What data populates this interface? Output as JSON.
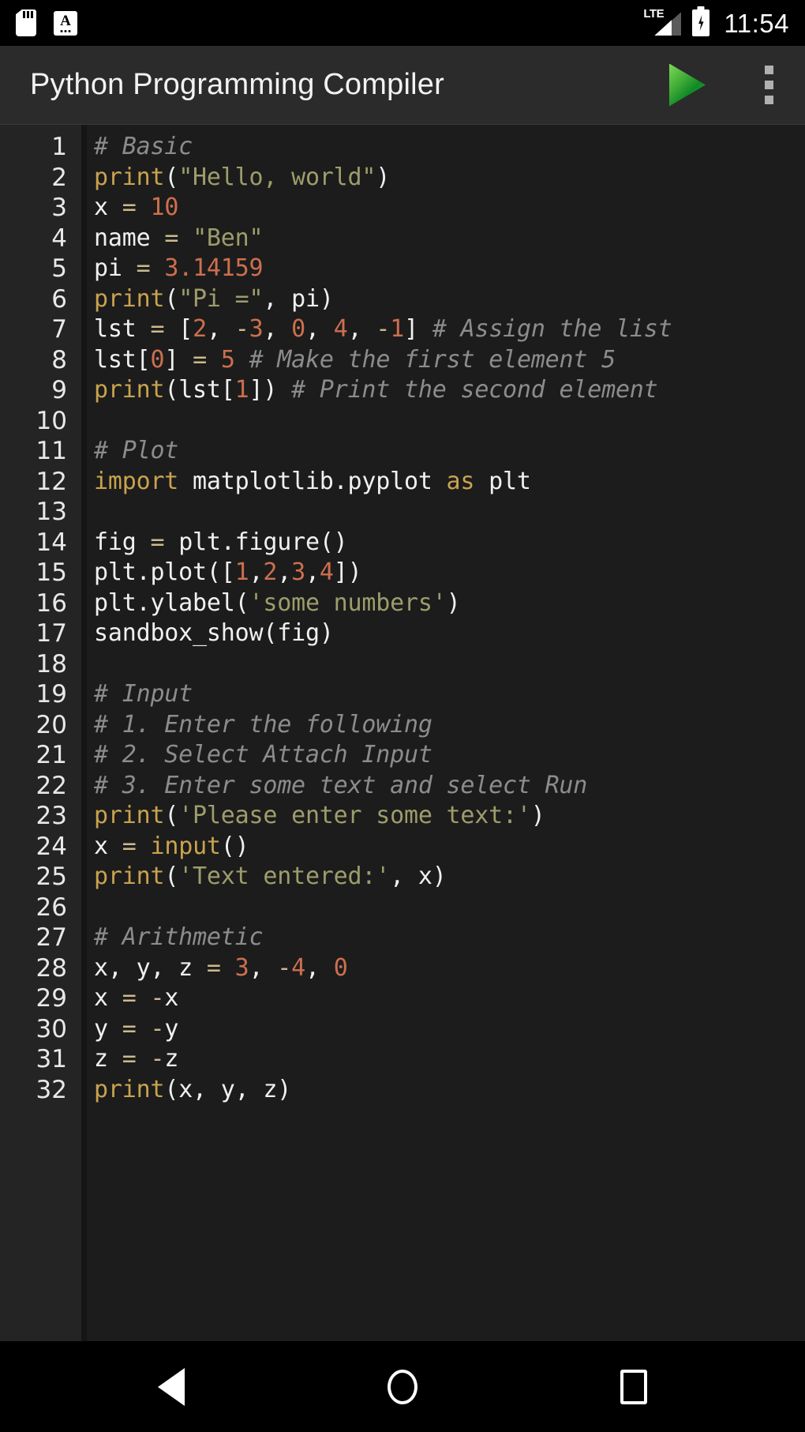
{
  "status_bar": {
    "icons_left": [
      {
        "name": "sd-card-icon",
        "label": "SD card"
      },
      {
        "name": "keyboard-icon",
        "label": "A"
      }
    ],
    "network_label": "LTE",
    "signal_icon": "signal-bars-icon",
    "battery_icon": "battery-charging-icon",
    "time": "11:54"
  },
  "app_bar": {
    "title": "Python Programming Compiler",
    "run_button": {
      "name": "run-button",
      "icon": "play-triangle-icon",
      "color": "#2eae3a"
    },
    "overflow_button": {
      "name": "overflow-menu-button",
      "icon": "three-dots-vertical-icon"
    }
  },
  "editor": {
    "background": "#1c1c1c",
    "gutter_background": "#242424",
    "token_colors": {
      "comment": "#8c8c8c",
      "keyword": "#c9a34e",
      "builtin": "#c9a34e",
      "string": "#9d9d6c",
      "number": "#cc6f4f",
      "operator": "#cbbb8c",
      "identifier": "#f0f0f0"
    },
    "lines": [
      {
        "n": "1",
        "tokens": [
          {
            "t": "com",
            "v": "# Basic"
          }
        ]
      },
      {
        "n": "2",
        "tokens": [
          {
            "t": "bi",
            "v": "print"
          },
          {
            "t": "pun",
            "v": "("
          },
          {
            "t": "str",
            "v": "\"Hello, world\""
          },
          {
            "t": "pun",
            "v": ")"
          }
        ]
      },
      {
        "n": "3",
        "tokens": [
          {
            "t": "id",
            "v": "x "
          },
          {
            "t": "op",
            "v": "="
          },
          {
            "t": "id",
            "v": " "
          },
          {
            "t": "num",
            "v": "10"
          }
        ]
      },
      {
        "n": "4",
        "tokens": [
          {
            "t": "id",
            "v": "name "
          },
          {
            "t": "op",
            "v": "="
          },
          {
            "t": "id",
            "v": " "
          },
          {
            "t": "str",
            "v": "\"Ben\""
          }
        ]
      },
      {
        "n": "5",
        "tokens": [
          {
            "t": "id",
            "v": "pi "
          },
          {
            "t": "op",
            "v": "="
          },
          {
            "t": "id",
            "v": " "
          },
          {
            "t": "num",
            "v": "3.14159"
          }
        ]
      },
      {
        "n": "6",
        "tokens": [
          {
            "t": "bi",
            "v": "print"
          },
          {
            "t": "pun",
            "v": "("
          },
          {
            "t": "str",
            "v": "\"Pi =\""
          },
          {
            "t": "pun",
            "v": ", "
          },
          {
            "t": "id",
            "v": "pi"
          },
          {
            "t": "pun",
            "v": ")"
          }
        ]
      },
      {
        "n": "7",
        "tokens": [
          {
            "t": "id",
            "v": "lst "
          },
          {
            "t": "op",
            "v": "="
          },
          {
            "t": "id",
            "v": " "
          },
          {
            "t": "pun",
            "v": "["
          },
          {
            "t": "num",
            "v": "2"
          },
          {
            "t": "pun",
            "v": ", "
          },
          {
            "t": "op",
            "v": "-"
          },
          {
            "t": "num",
            "v": "3"
          },
          {
            "t": "pun",
            "v": ", "
          },
          {
            "t": "num",
            "v": "0"
          },
          {
            "t": "pun",
            "v": ", "
          },
          {
            "t": "num",
            "v": "4"
          },
          {
            "t": "pun",
            "v": ", "
          },
          {
            "t": "op",
            "v": "-"
          },
          {
            "t": "num",
            "v": "1"
          },
          {
            "t": "pun",
            "v": "] "
          },
          {
            "t": "com",
            "v": "# Assign the list"
          }
        ]
      },
      {
        "n": "8",
        "tokens": [
          {
            "t": "id",
            "v": "lst"
          },
          {
            "t": "pun",
            "v": "["
          },
          {
            "t": "num",
            "v": "0"
          },
          {
            "t": "pun",
            "v": "] "
          },
          {
            "t": "op",
            "v": "="
          },
          {
            "t": "id",
            "v": " "
          },
          {
            "t": "num",
            "v": "5"
          },
          {
            "t": "id",
            "v": " "
          },
          {
            "t": "com",
            "v": "# Make the first element 5"
          }
        ]
      },
      {
        "n": "9",
        "tokens": [
          {
            "t": "bi",
            "v": "print"
          },
          {
            "t": "pun",
            "v": "("
          },
          {
            "t": "id",
            "v": "lst"
          },
          {
            "t": "pun",
            "v": "["
          },
          {
            "t": "num",
            "v": "1"
          },
          {
            "t": "pun",
            "v": "]) "
          },
          {
            "t": "com",
            "v": "# Print the second element"
          }
        ]
      },
      {
        "n": "10",
        "tokens": []
      },
      {
        "n": "11",
        "tokens": [
          {
            "t": "com",
            "v": "# Plot"
          }
        ]
      },
      {
        "n": "12",
        "tokens": [
          {
            "t": "kw",
            "v": "import"
          },
          {
            "t": "id",
            "v": " matplotlib.pyplot "
          },
          {
            "t": "kw",
            "v": "as"
          },
          {
            "t": "id",
            "v": " plt"
          }
        ]
      },
      {
        "n": "13",
        "tokens": []
      },
      {
        "n": "14",
        "tokens": [
          {
            "t": "id",
            "v": "fig "
          },
          {
            "t": "op",
            "v": "="
          },
          {
            "t": "id",
            "v": " plt.figure"
          },
          {
            "t": "pun",
            "v": "()"
          }
        ]
      },
      {
        "n": "15",
        "tokens": [
          {
            "t": "id",
            "v": "plt.plot"
          },
          {
            "t": "pun",
            "v": "(["
          },
          {
            "t": "num",
            "v": "1"
          },
          {
            "t": "pun",
            "v": ","
          },
          {
            "t": "num",
            "v": "2"
          },
          {
            "t": "pun",
            "v": ","
          },
          {
            "t": "num",
            "v": "3"
          },
          {
            "t": "pun",
            "v": ","
          },
          {
            "t": "num",
            "v": "4"
          },
          {
            "t": "pun",
            "v": "])"
          }
        ]
      },
      {
        "n": "16",
        "tokens": [
          {
            "t": "id",
            "v": "plt.ylabel"
          },
          {
            "t": "pun",
            "v": "("
          },
          {
            "t": "str",
            "v": "'some numbers'"
          },
          {
            "t": "pun",
            "v": ")"
          }
        ]
      },
      {
        "n": "17",
        "tokens": [
          {
            "t": "id",
            "v": "sandbox_show"
          },
          {
            "t": "pun",
            "v": "("
          },
          {
            "t": "id",
            "v": "fig"
          },
          {
            "t": "pun",
            "v": ")"
          }
        ]
      },
      {
        "n": "18",
        "tokens": []
      },
      {
        "n": "19",
        "tokens": [
          {
            "t": "com",
            "v": "# Input"
          }
        ]
      },
      {
        "n": "20",
        "tokens": [
          {
            "t": "com",
            "v": "# 1. Enter the following"
          }
        ]
      },
      {
        "n": "21",
        "tokens": [
          {
            "t": "com",
            "v": "# 2. Select Attach Input"
          }
        ]
      },
      {
        "n": "22",
        "tokens": [
          {
            "t": "com",
            "v": "# 3. Enter some text and select Run"
          }
        ]
      },
      {
        "n": "23",
        "tokens": [
          {
            "t": "bi",
            "v": "print"
          },
          {
            "t": "pun",
            "v": "("
          },
          {
            "t": "str",
            "v": "'Please enter some text:'"
          },
          {
            "t": "pun",
            "v": ")"
          }
        ]
      },
      {
        "n": "24",
        "tokens": [
          {
            "t": "id",
            "v": "x "
          },
          {
            "t": "op",
            "v": "="
          },
          {
            "t": "id",
            "v": " "
          },
          {
            "t": "bi",
            "v": "input"
          },
          {
            "t": "pun",
            "v": "()"
          }
        ]
      },
      {
        "n": "25",
        "tokens": [
          {
            "t": "bi",
            "v": "print"
          },
          {
            "t": "pun",
            "v": "("
          },
          {
            "t": "str",
            "v": "'Text entered:'"
          },
          {
            "t": "pun",
            "v": ", "
          },
          {
            "t": "id",
            "v": "x"
          },
          {
            "t": "pun",
            "v": ")"
          }
        ]
      },
      {
        "n": "26",
        "tokens": []
      },
      {
        "n": "27",
        "tokens": [
          {
            "t": "com",
            "v": "# Arithmetic"
          }
        ]
      },
      {
        "n": "28",
        "tokens": [
          {
            "t": "id",
            "v": "x, y, z "
          },
          {
            "t": "op",
            "v": "="
          },
          {
            "t": "id",
            "v": " "
          },
          {
            "t": "num",
            "v": "3"
          },
          {
            "t": "pun",
            "v": ", "
          },
          {
            "t": "op",
            "v": "-"
          },
          {
            "t": "num",
            "v": "4"
          },
          {
            "t": "pun",
            "v": ", "
          },
          {
            "t": "num",
            "v": "0"
          }
        ]
      },
      {
        "n": "29",
        "tokens": [
          {
            "t": "id",
            "v": "x "
          },
          {
            "t": "op",
            "v": "="
          },
          {
            "t": "id",
            "v": " "
          },
          {
            "t": "op",
            "v": "-"
          },
          {
            "t": "id",
            "v": "x"
          }
        ]
      },
      {
        "n": "30",
        "tokens": [
          {
            "t": "id",
            "v": "y "
          },
          {
            "t": "op",
            "v": "="
          },
          {
            "t": "id",
            "v": " "
          },
          {
            "t": "op",
            "v": "-"
          },
          {
            "t": "id",
            "v": "y"
          }
        ]
      },
      {
        "n": "31",
        "tokens": [
          {
            "t": "id",
            "v": "z "
          },
          {
            "t": "op",
            "v": "="
          },
          {
            "t": "id",
            "v": " "
          },
          {
            "t": "op",
            "v": "-"
          },
          {
            "t": "id",
            "v": "z"
          }
        ]
      },
      {
        "n": "32",
        "tokens": [
          {
            "t": "bi",
            "v": "print"
          },
          {
            "t": "pun",
            "v": "("
          },
          {
            "t": "id",
            "v": "x, y, z"
          },
          {
            "t": "pun",
            "v": ")"
          }
        ]
      }
    ]
  },
  "nav_bar": {
    "buttons": [
      {
        "name": "nav-back-button",
        "icon": "back-triangle-icon"
      },
      {
        "name": "nav-home-button",
        "icon": "home-circle-icon"
      },
      {
        "name": "nav-recents-button",
        "icon": "recents-square-icon"
      }
    ]
  }
}
